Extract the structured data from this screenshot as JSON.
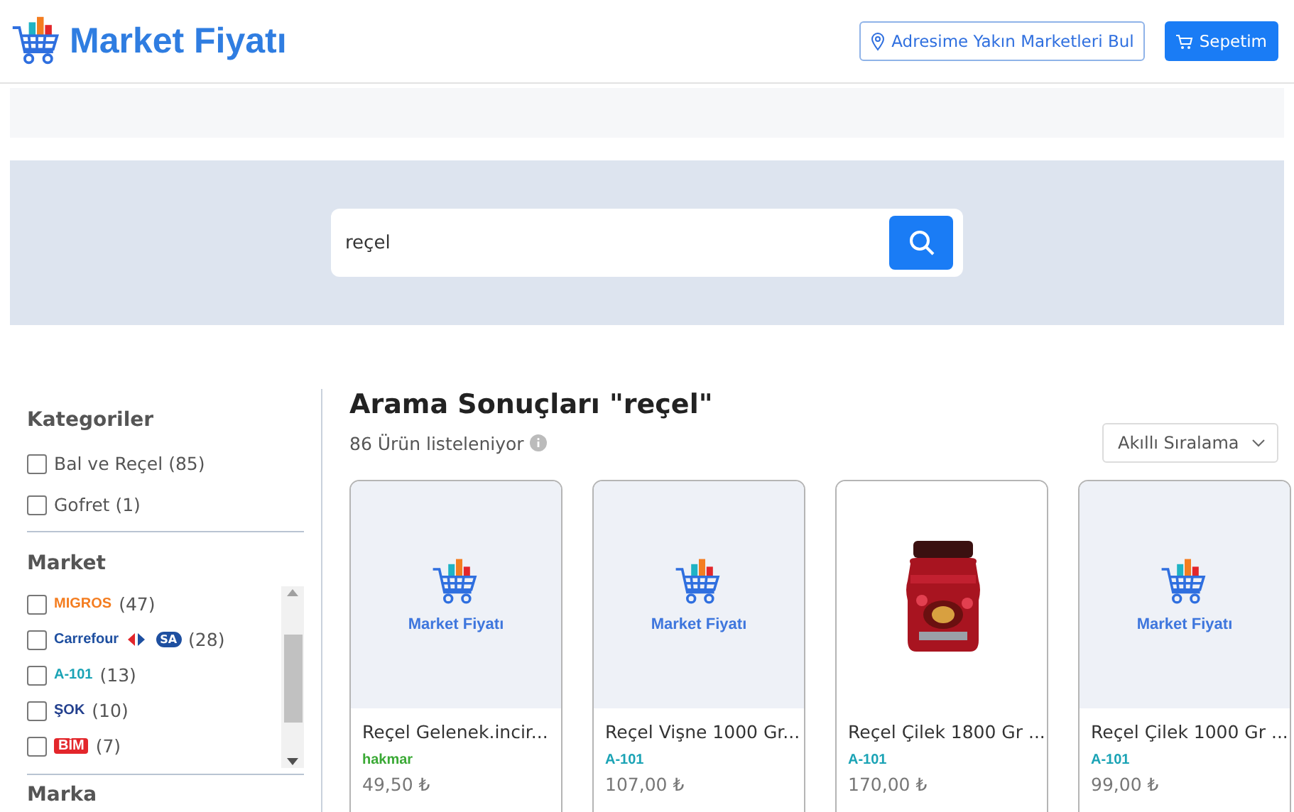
{
  "header": {
    "logo": "Market Fiyatı",
    "location_button": "Adresime Yakın Marketleri Bul",
    "cart_button": "Sepetim"
  },
  "search": {
    "value": "reçel"
  },
  "categories": {
    "title": "Kategoriler",
    "options": [
      {
        "label": "Bal ve Reçel",
        "count": "(85)",
        "checked": false
      },
      {
        "label": "Gofret",
        "count": "(1)",
        "checked": false
      }
    ]
  },
  "markets": {
    "title": "Market",
    "options": [
      {
        "logo": "MIGROS",
        "kind": "text",
        "color": "#f47d20",
        "count": "(47)",
        "checked": false
      },
      {
        "logo": "Carrefour",
        "kind": "carrefour",
        "badge": "SA",
        "color": "#1e4fa0",
        "count": "(28)",
        "checked": false
      },
      {
        "logo": "A-101",
        "kind": "text",
        "color": "#1aa3b5",
        "count": "(13)",
        "checked": false
      },
      {
        "logo": "ŞOK",
        "kind": "text",
        "color": "#23408e",
        "count": "(10)",
        "checked": false
      },
      {
        "logo": "BİM",
        "kind": "boxed",
        "color": "#e3262b",
        "count": "(7)",
        "checked": false
      }
    ]
  },
  "brands": {
    "title": "Marka"
  },
  "results": {
    "title": "Arama Sonuçları \"reçel\"",
    "count": "86 Ürün listeleniyor",
    "sort": "Akıllı Sıralama",
    "products": [
      {
        "kind": "placeholder",
        "placeholder_text": "Market Fiyatı",
        "name": "Reçel Gelenek.incir...",
        "market": "hakmar",
        "color": "#3aa935",
        "price": "49,50 ₺"
      },
      {
        "kind": "placeholder",
        "placeholder_text": "Market Fiyatı",
        "name": "Reçel Vişne 1000 Gr...",
        "market": "A-101",
        "color": "#1aa3b5",
        "price": "107,00 ₺"
      },
      {
        "kind": "picture",
        "name": "Reçel Çilek 1800 Gr ...",
        "market": "A-101",
        "color": "#1aa3b5",
        "price": "170,00 ₺"
      },
      {
        "kind": "placeholder",
        "placeholder_text": "Market Fiyatı",
        "name": "Reçel Çilek 1000 Gr ...",
        "market": "A-101",
        "color": "#1aa3b5",
        "price": "99,00 ₺"
      }
    ]
  }
}
